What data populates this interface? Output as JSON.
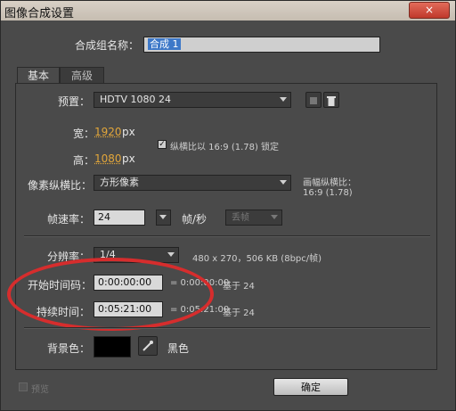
{
  "window": {
    "title": "图像合成设置",
    "close_icon": "×"
  },
  "composition": {
    "name_label": "合成组名称：",
    "name_value": "合成 1"
  },
  "tabs": [
    {
      "label": "基本"
    },
    {
      "label": "高级"
    }
  ],
  "preset": {
    "label": "预置：",
    "value": "HDTV 1080 24"
  },
  "size": {
    "width_label": "宽：",
    "width_value": "1920",
    "width_unit": "px",
    "height_label": "高：",
    "height_value": "1080",
    "height_unit": "px",
    "lock_label": "纵横比以 16:9 (1.78) 锁定",
    "lock_checked": true
  },
  "pixel_aspect": {
    "label": "像素纵横比：",
    "value": "方形像素",
    "frame_aspect_label": "画幅纵横比：",
    "frame_aspect_value": "16:9 (1.78)"
  },
  "frame_rate": {
    "label": "帧速率：",
    "value": "24",
    "unit": "帧/秒",
    "drop_value": "丢帧"
  },
  "resolution": {
    "label": "分辨率：",
    "value": "1/4",
    "info": "480 x 270，506 KB (8bpc/帧)"
  },
  "start_timecode": {
    "label": "开始时间码：",
    "value": "0:00:00:00",
    "equals_text": "= 0:00:00:00",
    "base_text": "基于 24"
  },
  "duration": {
    "label": "持续时间：",
    "value": "0:05:21:00",
    "equals_text": "= 0:05:21:00",
    "base_text": "基于 24"
  },
  "background": {
    "label": "背景色：",
    "color": "#000000",
    "color_name": "黑色"
  },
  "footer": {
    "preview_label": "预览",
    "ok_label": "确定"
  }
}
